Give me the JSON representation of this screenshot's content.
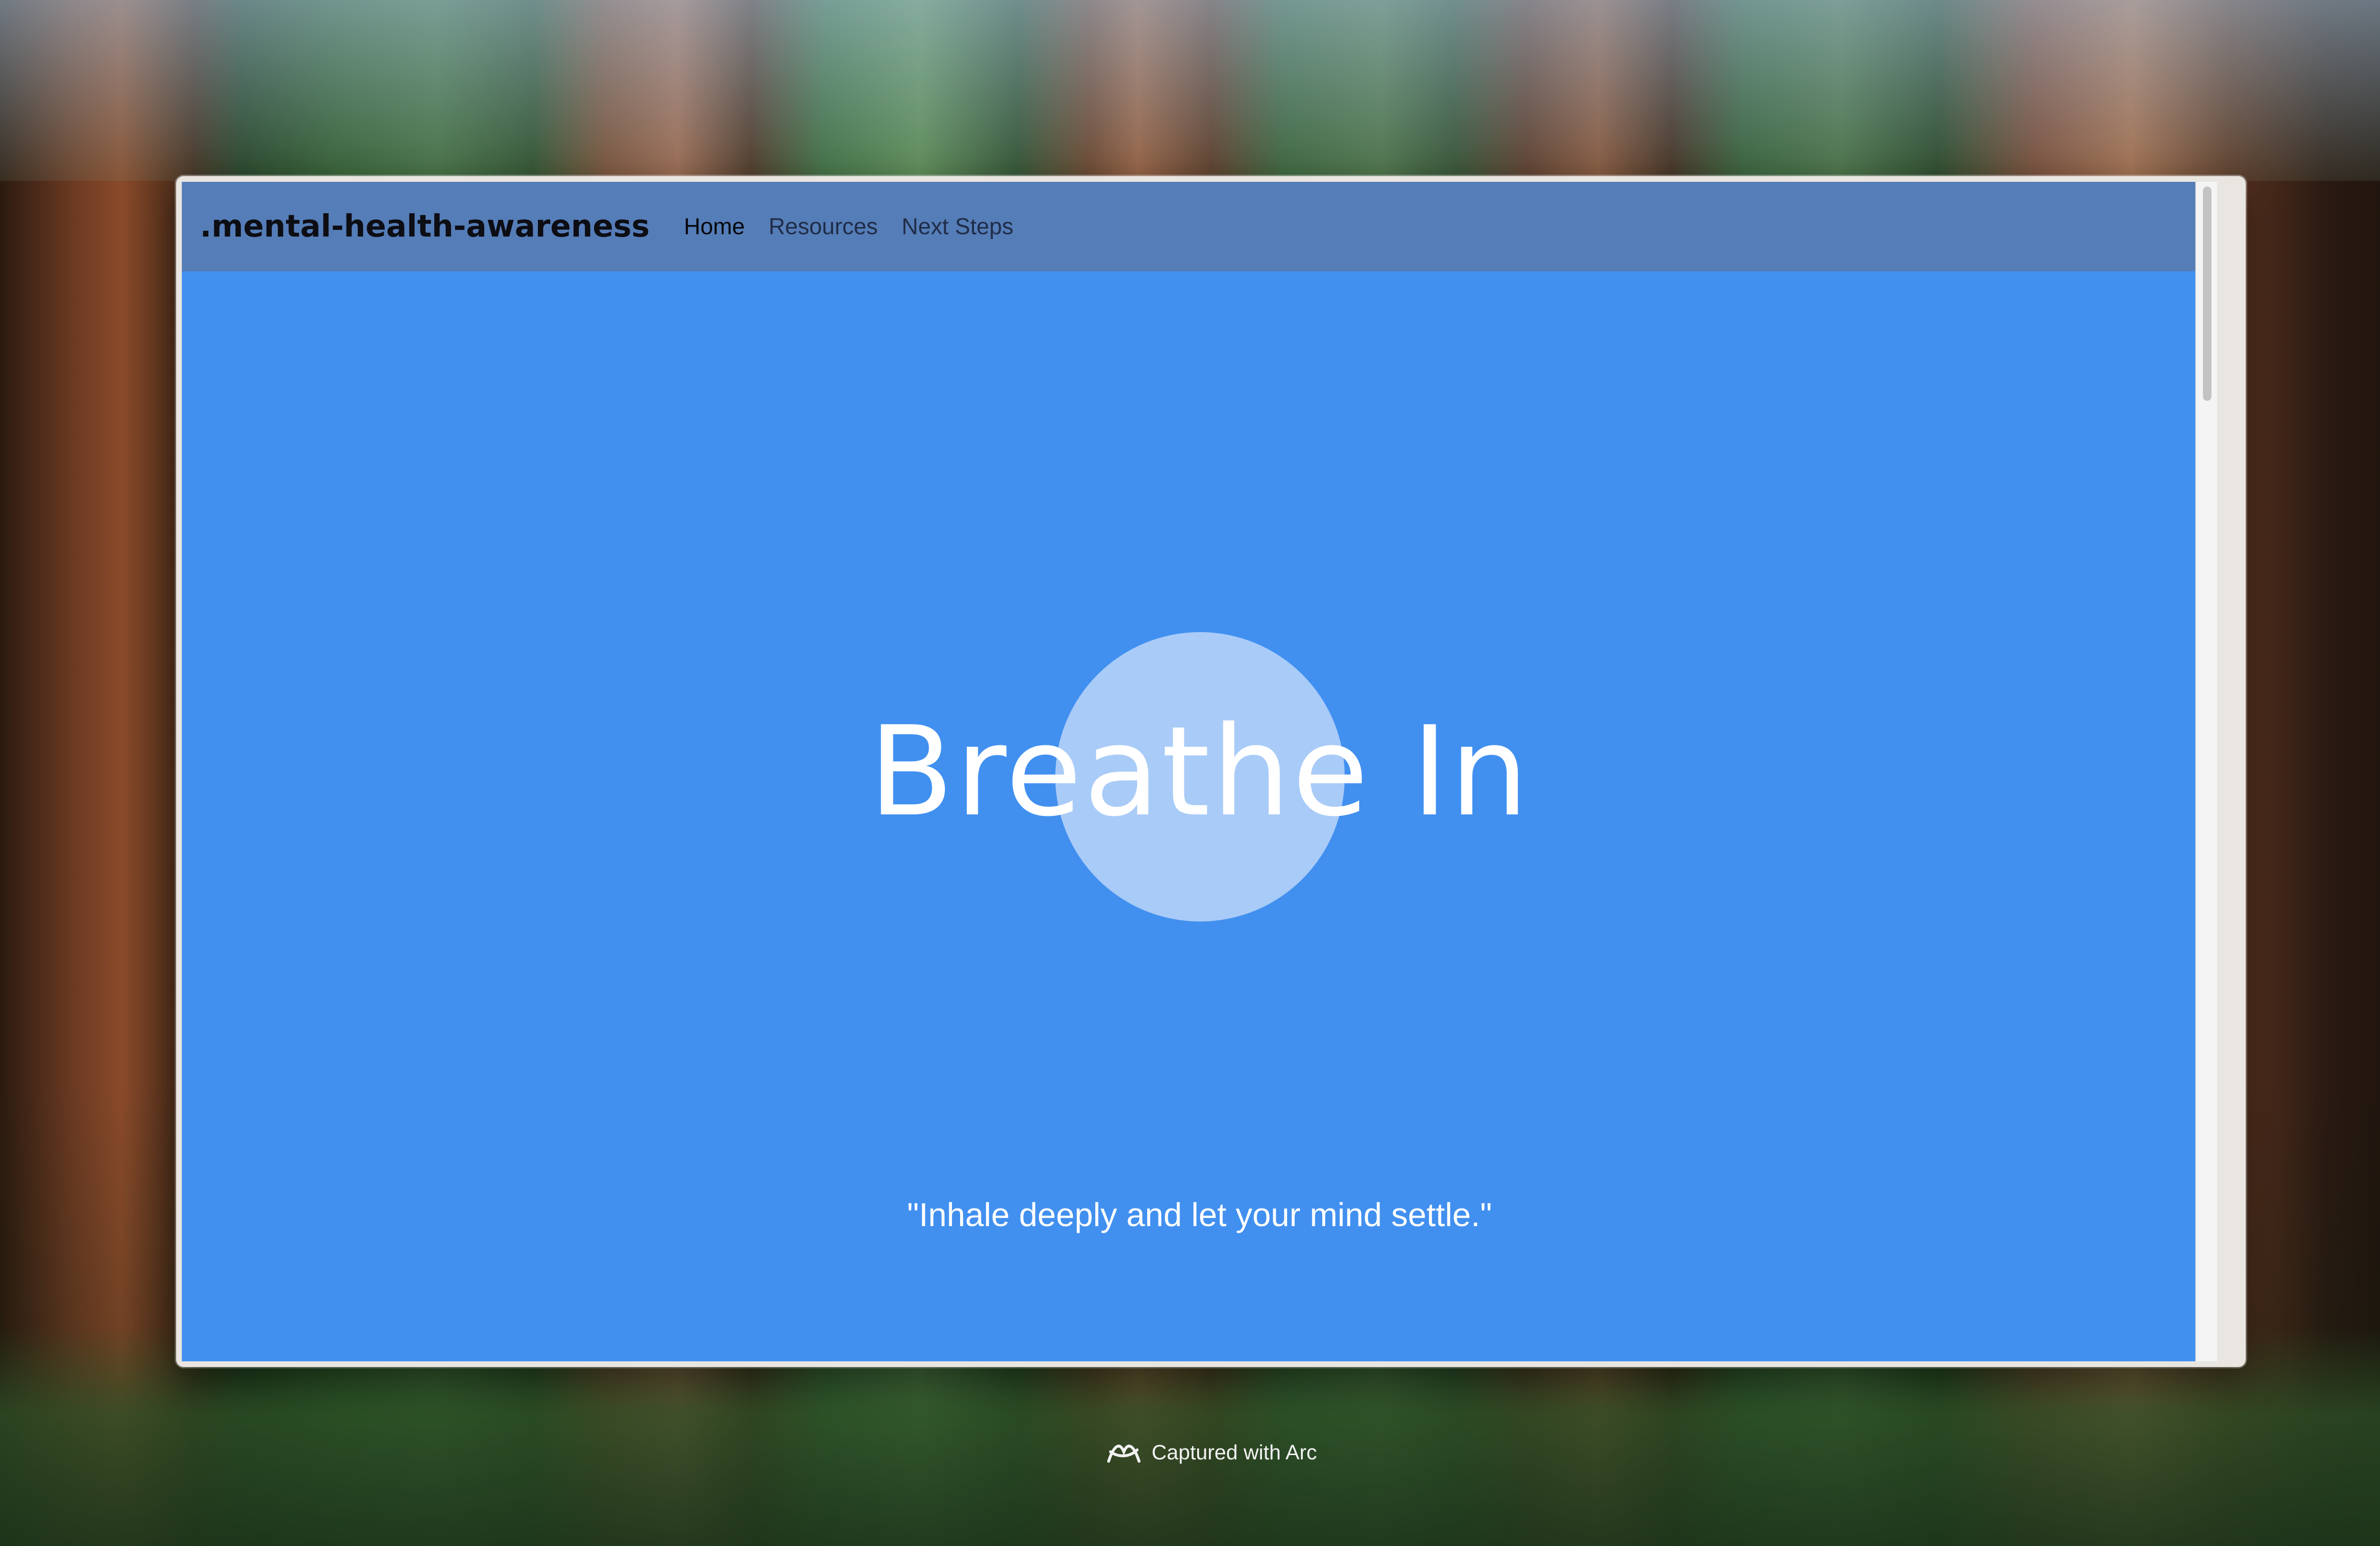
{
  "navbar": {
    "brand": ".mental-health-awareness",
    "links": [
      {
        "label": "Home",
        "active": true
      },
      {
        "label": "Resources",
        "active": false
      },
      {
        "label": "Next Steps",
        "active": false
      }
    ]
  },
  "hero": {
    "title": "Breathe In",
    "quote": "\"Inhale deeply and let your mind settle.\""
  },
  "capture": {
    "text": "Captured with Arc",
    "icon": "arc-logo-icon"
  },
  "colors": {
    "background": "#4190f0",
    "navbar": "#557db7",
    "circle": "#a9cbf8",
    "text": "#ffffff"
  }
}
